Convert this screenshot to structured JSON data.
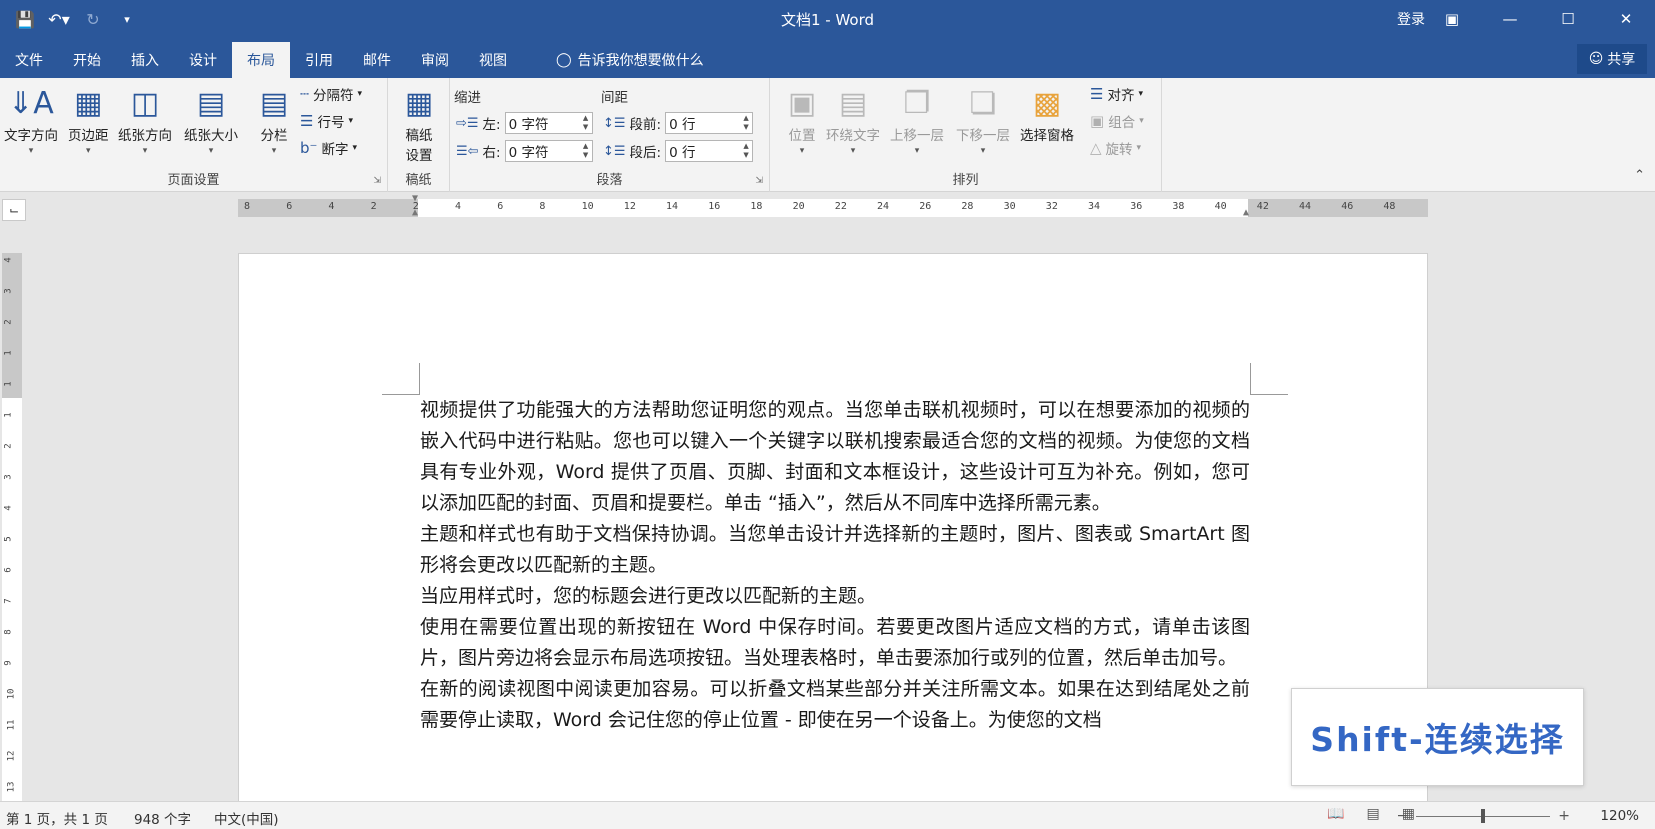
{
  "titlebar": {
    "title": "文档1  -  Word",
    "login": "登录"
  },
  "tabs": [
    "文件",
    "开始",
    "插入",
    "设计",
    "布局",
    "引用",
    "邮件",
    "审阅",
    "视图"
  ],
  "active_tab": "布局",
  "tellme": "告诉我你想要做什么",
  "share": "共享",
  "ribbon": {
    "page_setup": {
      "label": "页面设置",
      "text_direction": "文字方向",
      "margins": "页边距",
      "orientation": "纸张方向",
      "size": "纸张大小",
      "columns": "分栏",
      "breaks": "分隔符",
      "line_numbers": "行号",
      "hyphenation": "断字"
    },
    "draft": {
      "label": "稿纸",
      "settings_line1": "稿纸",
      "settings_line2": "设置"
    },
    "paragraph": {
      "label": "段落",
      "indent_title": "缩进",
      "spacing_title": "间距",
      "left_label": "左:",
      "left_value": "0 字符",
      "right_label": "右:",
      "right_value": "0 字符",
      "before_label": "段前:",
      "before_value": "0 行",
      "after_label": "段后:",
      "after_value": "0 行"
    },
    "arrange": {
      "label": "排列",
      "position": "位置",
      "wrap_text": "环绕文字",
      "bring_forward": "上移一层",
      "send_backward": "下移一层",
      "selection_pane": "选择窗格",
      "align": "对齐",
      "group": "组合",
      "rotate": "旋转"
    }
  },
  "ruler": {
    "horizontal": [
      "8",
      "6",
      "4",
      "2",
      "2",
      "4",
      "6",
      "8",
      "10",
      "12",
      "14",
      "16",
      "18",
      "20",
      "22",
      "24",
      "26",
      "28",
      "30",
      "32",
      "34",
      "36",
      "38",
      "40",
      "42",
      "44",
      "46",
      "48"
    ],
    "vertical": [
      "4",
      "3",
      "2",
      "1",
      "1",
      "1",
      "2",
      "3",
      "4",
      "5",
      "6",
      "7",
      "8",
      "9",
      "10",
      "11",
      "12",
      "13"
    ]
  },
  "document": {
    "paragraphs": [
      "视频提供了功能强大的方法帮助您证明您的观点。当您单击联机视频时，可以在想要添加的视频的嵌入代码中进行粘贴。您也可以键入一个关键字以联机搜索最适合您的文档的视频。为使您的文档具有专业外观，Word 提供了页眉、页脚、封面和文本框设计，这些设计可互为补充。例如，您可以添加匹配的封面、页眉和提要栏。单击 “插入”，然后从不同库中选择所需元素。",
      "主题和样式也有助于文档保持协调。当您单击设计并选择新的主题时，图片、图表或 SmartArt 图形将会更改以匹配新的主题。",
      "当应用样式时，您的标题会进行更改以匹配新的主题。",
      "使用在需要位置出现的新按钮在 Word 中保存时间。若要更改图片适应文档的方式，请单击该图片，图片旁边将会显示布局选项按钮。当处理表格时，单击要添加行或列的位置，然后单击加号。",
      "在新的阅读视图中阅读更加容易。可以折叠文档某些部分并关注所需文本。如果在达到结尾处之前需要停止读取，Word 会记住您的停止位置 - 即使在另一个设备上。为使您的文档"
    ]
  },
  "overlay": {
    "text": "Shift-连续选择"
  },
  "status": {
    "page": "第 1 页，共 1 页",
    "words": "948 个字",
    "language": "中文(中国)",
    "zoom": "120%"
  },
  "colors": {
    "brand": "#2b579a",
    "overlay_text": "#3467c4"
  }
}
